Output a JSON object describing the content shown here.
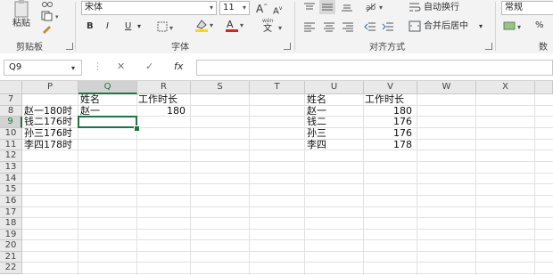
{
  "ribbon": {
    "clipboard": {
      "paste_label": "粘贴",
      "group_label": "剪贴板"
    },
    "font": {
      "font_name": "宋体",
      "font_size": "11",
      "grow_label": "A",
      "shrink_label": "A",
      "bold": "B",
      "italic": "I",
      "underline": "U",
      "group_label": "字体",
      "wen_label": "wén"
    },
    "alignment": {
      "wrap_label": "自动换行",
      "merge_label": "合并后居中",
      "group_label": "对齐方式"
    },
    "number": {
      "format": "常规",
      "percent": "%",
      "group_label": "数字"
    }
  },
  "formula_bar": {
    "name_box": "Q9",
    "cancel": "✕",
    "enter": "✓",
    "fx": "fx",
    "value": ""
  },
  "columns": [
    "P",
    "Q",
    "R",
    "S",
    "T",
    "U",
    "V",
    "W",
    "X"
  ],
  "rows": [
    "7",
    "8",
    "9",
    "10",
    "11",
    "12",
    "13",
    "14",
    "15",
    "16",
    "17",
    "18",
    "19",
    "20",
    "21",
    "22"
  ],
  "cells": {
    "Q7": "姓名",
    "R7": "工作时长",
    "U7": "姓名",
    "V7": "工作时长",
    "P8": "赵一180时",
    "Q8": "赵一",
    "R8": "180",
    "U8": "赵一",
    "V8": "180",
    "P9": "钱二176时",
    "U9": "钱二",
    "V9": "176",
    "P10": "孙三176时",
    "U10": "孙三",
    "V10": "176",
    "P11": "李四178时",
    "U11": "李四",
    "V11": "178"
  },
  "colors": {
    "accent": "#217346",
    "font_color_bar": "#e02020",
    "highlight_bar": "#ffd800"
  }
}
